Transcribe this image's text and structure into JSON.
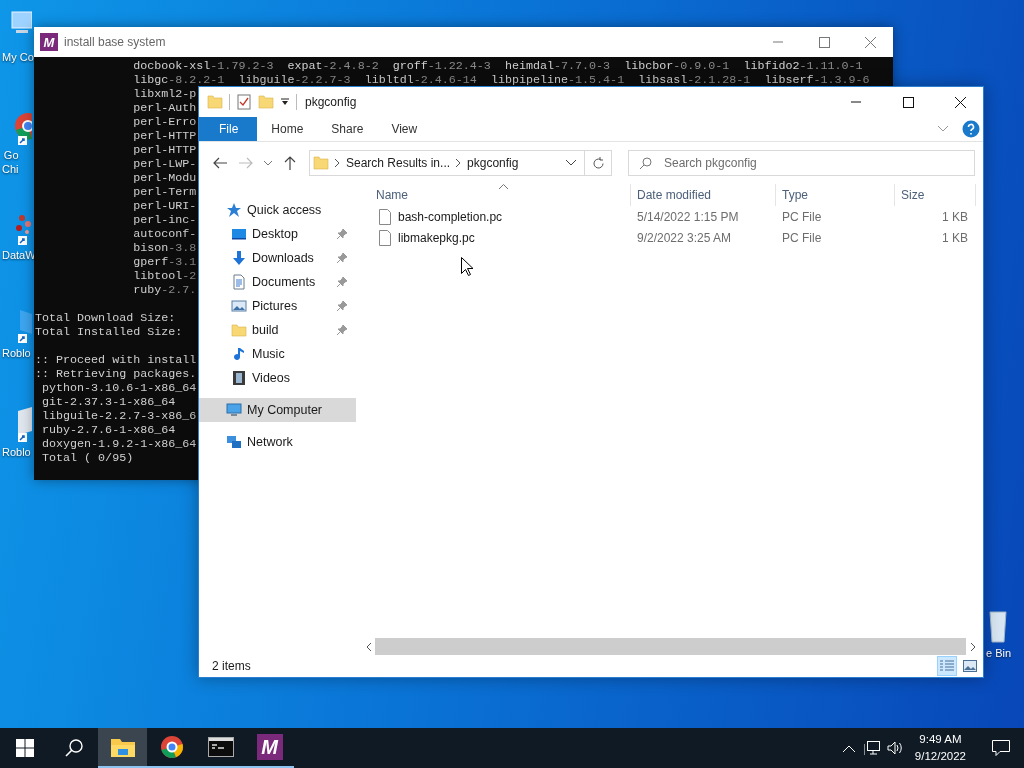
{
  "desktop_icons": [
    {
      "kind": "computer",
      "label": [
        "My Co"
      ]
    },
    {
      "kind": "chrome",
      "label": [
        "Go",
        "Chi"
      ]
    },
    {
      "kind": "chart",
      "label": [
        "DataW"
      ]
    },
    {
      "kind": "app",
      "label": [
        "Roblo"
      ]
    },
    {
      "kind": "app-light",
      "label": [
        "Roblo"
      ]
    },
    {
      "kind": "recycle",
      "label": [
        "e Bin"
      ]
    }
  ],
  "terminal": {
    "logo": "M",
    "title": "install base system",
    "lines": [
      {
        "kind": "packages",
        "packages": [
          {
            "name": "docbook-xsl",
            "version": "-1.79.2-3"
          },
          {
            "name": "expat",
            "version": "-2.4.8-2"
          },
          {
            "name": "groff",
            "version": "-1.22.4-3"
          },
          {
            "name": "heimdal",
            "version": "-7.7.0-3"
          },
          {
            "name": "libcbor",
            "version": "-0.9.0-1"
          },
          {
            "name": "libfido2",
            "version": "-1.11.0-1"
          }
        ]
      },
      {
        "kind": "packages",
        "packages": [
          {
            "name": "libgc",
            "version": "-8.2.2-1"
          },
          {
            "name": "libguile",
            "version": "-2.2.7-3"
          },
          {
            "name": "libltdl",
            "version": "-2.4.6-14"
          },
          {
            "name": "libpipeline",
            "version": "-1.5.4-1"
          },
          {
            "name": "libsasl",
            "version": "-2.1.28-1"
          },
          {
            "name": "libserf",
            "version": "-1.3.9-6"
          }
        ]
      },
      {
        "kind": "packages",
        "packages": [
          {
            "name": "libxml2-p"
          }
        ]
      },
      {
        "kind": "packages",
        "packages": [
          {
            "name": "perl-Auth"
          }
        ]
      },
      {
        "kind": "packages",
        "packages": [
          {
            "name": "perl-Erro"
          }
        ]
      },
      {
        "kind": "packages",
        "packages": [
          {
            "name": "perl-HTTP"
          }
        ]
      },
      {
        "kind": "packages",
        "packages": [
          {
            "name": "perl-HTTP"
          }
        ]
      },
      {
        "kind": "packages",
        "packages": [
          {
            "name": "perl-LWP-"
          }
        ]
      },
      {
        "kind": "packages",
        "packages": [
          {
            "name": "perl-Modu"
          }
        ]
      },
      {
        "kind": "packages",
        "packages": [
          {
            "name": "perl-Term"
          }
        ]
      },
      {
        "kind": "packages",
        "packages": [
          {
            "name": "perl-URI-"
          }
        ]
      },
      {
        "kind": "packages",
        "packages": [
          {
            "name": "perl-inc-"
          }
        ]
      },
      {
        "kind": "packages",
        "packages": [
          {
            "name": "autoconf-"
          }
        ]
      },
      {
        "kind": "packages",
        "packages": [
          {
            "name": "bison",
            "version": "-3.8"
          }
        ]
      },
      {
        "kind": "packages",
        "packages": [
          {
            "name": "gperf",
            "version": "-3.1"
          }
        ]
      },
      {
        "kind": "packages",
        "packages": [
          {
            "name": "libtool",
            "version": "-2"
          }
        ]
      },
      {
        "kind": "packages",
        "packages": [
          {
            "name": "ruby",
            "version": "-2.7."
          }
        ]
      },
      {
        "kind": "blank"
      },
      {
        "kind": "text",
        "text": "Total Download Size:"
      },
      {
        "kind": "text",
        "text": "Total Installed Size:"
      },
      {
        "kind": "blank"
      },
      {
        "kind": "text",
        "text": ":: Proceed with install"
      },
      {
        "kind": "text",
        "text": ":: Retrieving packages."
      },
      {
        "kind": "progress",
        "text": "python-3.10.6-1-x86_64"
      },
      {
        "kind": "progress",
        "text": "git-2.37.3-1-x86_64"
      },
      {
        "kind": "progress",
        "text": "libguile-2.2.7-3-x86_6"
      },
      {
        "kind": "progress",
        "text": "ruby-2.7.6-1-x86_64"
      },
      {
        "kind": "progress",
        "text": "doxygen-1.9.2-1-x86_64"
      },
      {
        "kind": "progress",
        "text": "Total ( 0/95)"
      }
    ]
  },
  "explorer": {
    "title": "pkgconfig",
    "ribbon_tabs": [
      {
        "label": "File",
        "selected": true
      },
      {
        "label": "Home",
        "selected": false
      },
      {
        "label": "Share",
        "selected": false
      },
      {
        "label": "View",
        "selected": false
      }
    ],
    "breadcrumb": [
      "Search Results in...",
      "pkgconfig"
    ],
    "search": {
      "placeholder": "Search pkgconfig"
    },
    "nav": [
      {
        "label": "Quick access",
        "kind": "star",
        "selected": false,
        "children": [
          {
            "label": "Desktop",
            "kind": "desktop",
            "pinned": true,
            "selected": false
          },
          {
            "label": "Downloads",
            "kind": "downloads",
            "pinned": true,
            "selected": false
          },
          {
            "label": "Documents",
            "kind": "documents",
            "pinned": true,
            "selected": false
          },
          {
            "label": "Pictures",
            "kind": "pictures",
            "pinned": true,
            "selected": false
          },
          {
            "label": "build",
            "kind": "folder",
            "pinned": true,
            "selected": false
          },
          {
            "label": "Music",
            "kind": "music",
            "pinned": false,
            "selected": false
          },
          {
            "label": "Videos",
            "kind": "videos",
            "pinned": false,
            "selected": false
          }
        ]
      },
      {
        "label": "My Computer",
        "kind": "computer",
        "selected": true
      },
      {
        "label": "Network",
        "kind": "network",
        "selected": false
      }
    ],
    "columns": [
      {
        "label": "Name",
        "sorted": true
      },
      {
        "label": "Date modified",
        "sorted": false
      },
      {
        "label": "Type",
        "sorted": false
      },
      {
        "label": "Size",
        "sorted": false
      }
    ],
    "rows": [
      {
        "name": "bash-completion.pc",
        "date": "5/14/2022 1:15 PM",
        "type": "PC File",
        "size": "1 KB"
      },
      {
        "name": "libmakepkg.pc",
        "date": "9/2/2022 3:25 AM",
        "type": "PC File",
        "size": "1 KB"
      }
    ],
    "status": "2 items",
    "views": [
      {
        "kind": "details",
        "selected": true
      },
      {
        "kind": "tiles",
        "selected": false
      }
    ]
  },
  "taskbar": {
    "apps": [
      {
        "kind": "explorer",
        "active": true,
        "running": true
      },
      {
        "kind": "chrome",
        "active": false,
        "running": true
      },
      {
        "kind": "terminal",
        "active": false,
        "running": true
      },
      {
        "kind": "logo",
        "text": "M",
        "active": false,
        "running": true
      }
    ],
    "time": "9:49 AM",
    "date": "9/12/2022"
  }
}
